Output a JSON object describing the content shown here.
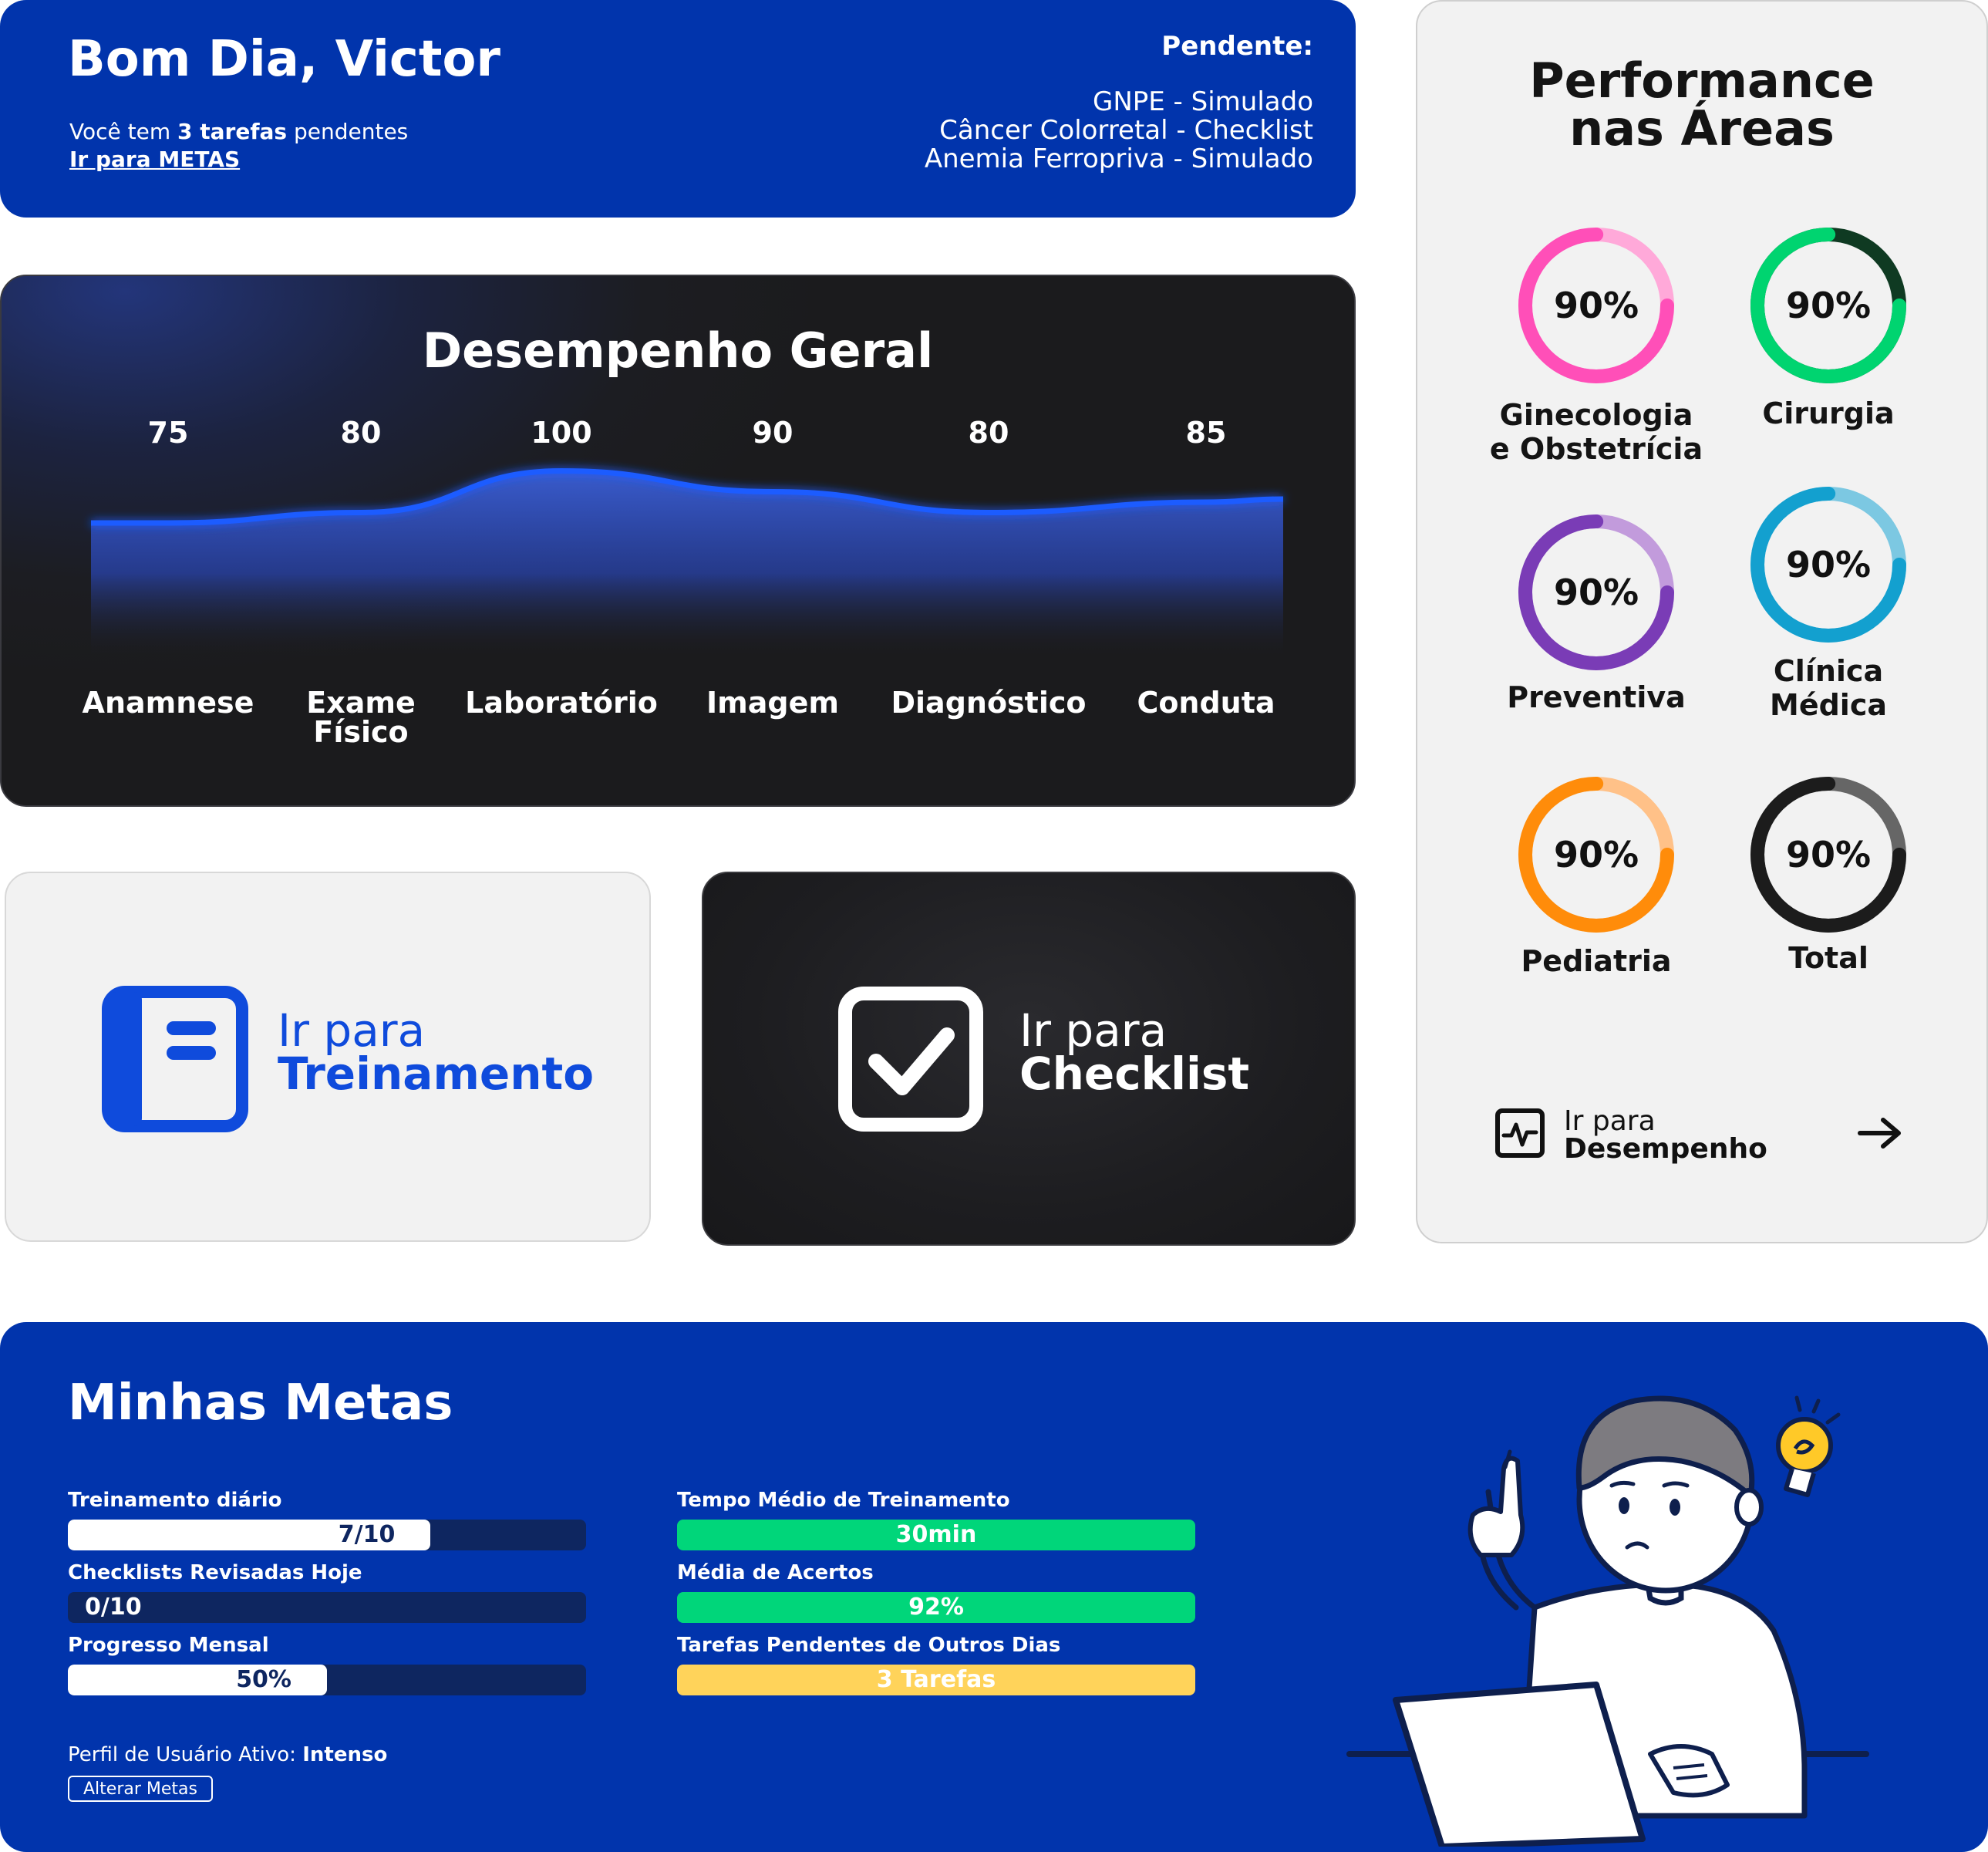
{
  "greeting": {
    "title": "Bom Dia, Victor",
    "line_prefix": "Você tem ",
    "line_count": "3 tarefas",
    "line_suffix": " pendentes",
    "link": "Ir para METAS",
    "pending_label": "Pendente:",
    "pending": [
      "GNPE - Simulado",
      "Câncer Colorretal - Checklist",
      "Anemia Ferropriva - Simulado"
    ]
  },
  "chart_data": {
    "type": "area",
    "title": "Desempenho Geral",
    "categories": [
      "Anamnese",
      "Exame\nFísico",
      "Laboratório",
      "Imagem",
      "Diagnóstico",
      "Conduta"
    ],
    "values": [
      75,
      80,
      100,
      90,
      80,
      85
    ],
    "colors": {
      "line": "#1f5cff",
      "fill": "#3b5fd6"
    }
  },
  "actions": {
    "treino": {
      "l1": "Ir para",
      "l2": "Treinamento",
      "color": "#0f4bdc"
    },
    "checklist": {
      "l1": "Ir para",
      "l2": "Checklist",
      "color": "#ffffff"
    }
  },
  "performance": {
    "title_1": "Performance",
    "title_2": "nas Áreas",
    "areas": [
      {
        "label": "Ginecologia\ne Obstetrícia",
        "value": "90%",
        "pct": 0.75,
        "color": "#ff4fb8",
        "track": "#ffa9d9"
      },
      {
        "label": "Cirurgia",
        "value": "90%",
        "pct": 0.75,
        "color": "#00d470",
        "track": "#0f3a22"
      },
      {
        "label": "Preventiva",
        "value": "90%",
        "pct": 0.75,
        "color": "#7a3cb6",
        "track": "#c29bdc"
      },
      {
        "label": "Clínica\nMédica",
        "value": "90%",
        "pct": 0.75,
        "color": "#13a0cf",
        "track": "#7cc8e2"
      },
      {
        "label": "Pediatria",
        "value": "90%",
        "pct": 0.75,
        "color": "#ff8c0a",
        "track": "#ffc188"
      },
      {
        "label": "Total",
        "value": "90%",
        "pct": 0.75,
        "color": "#1c1c1c",
        "track": "#666666"
      }
    ],
    "link_l1": "Ir para",
    "link_l2": "Desempenho"
  },
  "metas": {
    "title": "Minhas Metas",
    "left": [
      {
        "label": "Treinamento diário",
        "value": "7/10",
        "progress": 0.7
      },
      {
        "label": "Checklists Revisadas Hoje",
        "value": "0/10",
        "progress": 0.0
      },
      {
        "label": "Progresso Mensal",
        "value": "50%",
        "progress": 0.5
      }
    ],
    "right": [
      {
        "label": "Tempo Médio de Treinamento",
        "value": "30min",
        "color": "#00d67a"
      },
      {
        "label": "Média de Acertos",
        "value": "92%",
        "color": "#00d67a"
      },
      {
        "label": "Tarefas Pendentes de Outros Dias",
        "value": "3 Tarefas",
        "color": "#ffd35a"
      }
    ],
    "profile_label": "Perfil de Usuário Ativo: ",
    "profile_value": "Intenso",
    "button": "Alterar Metas"
  }
}
